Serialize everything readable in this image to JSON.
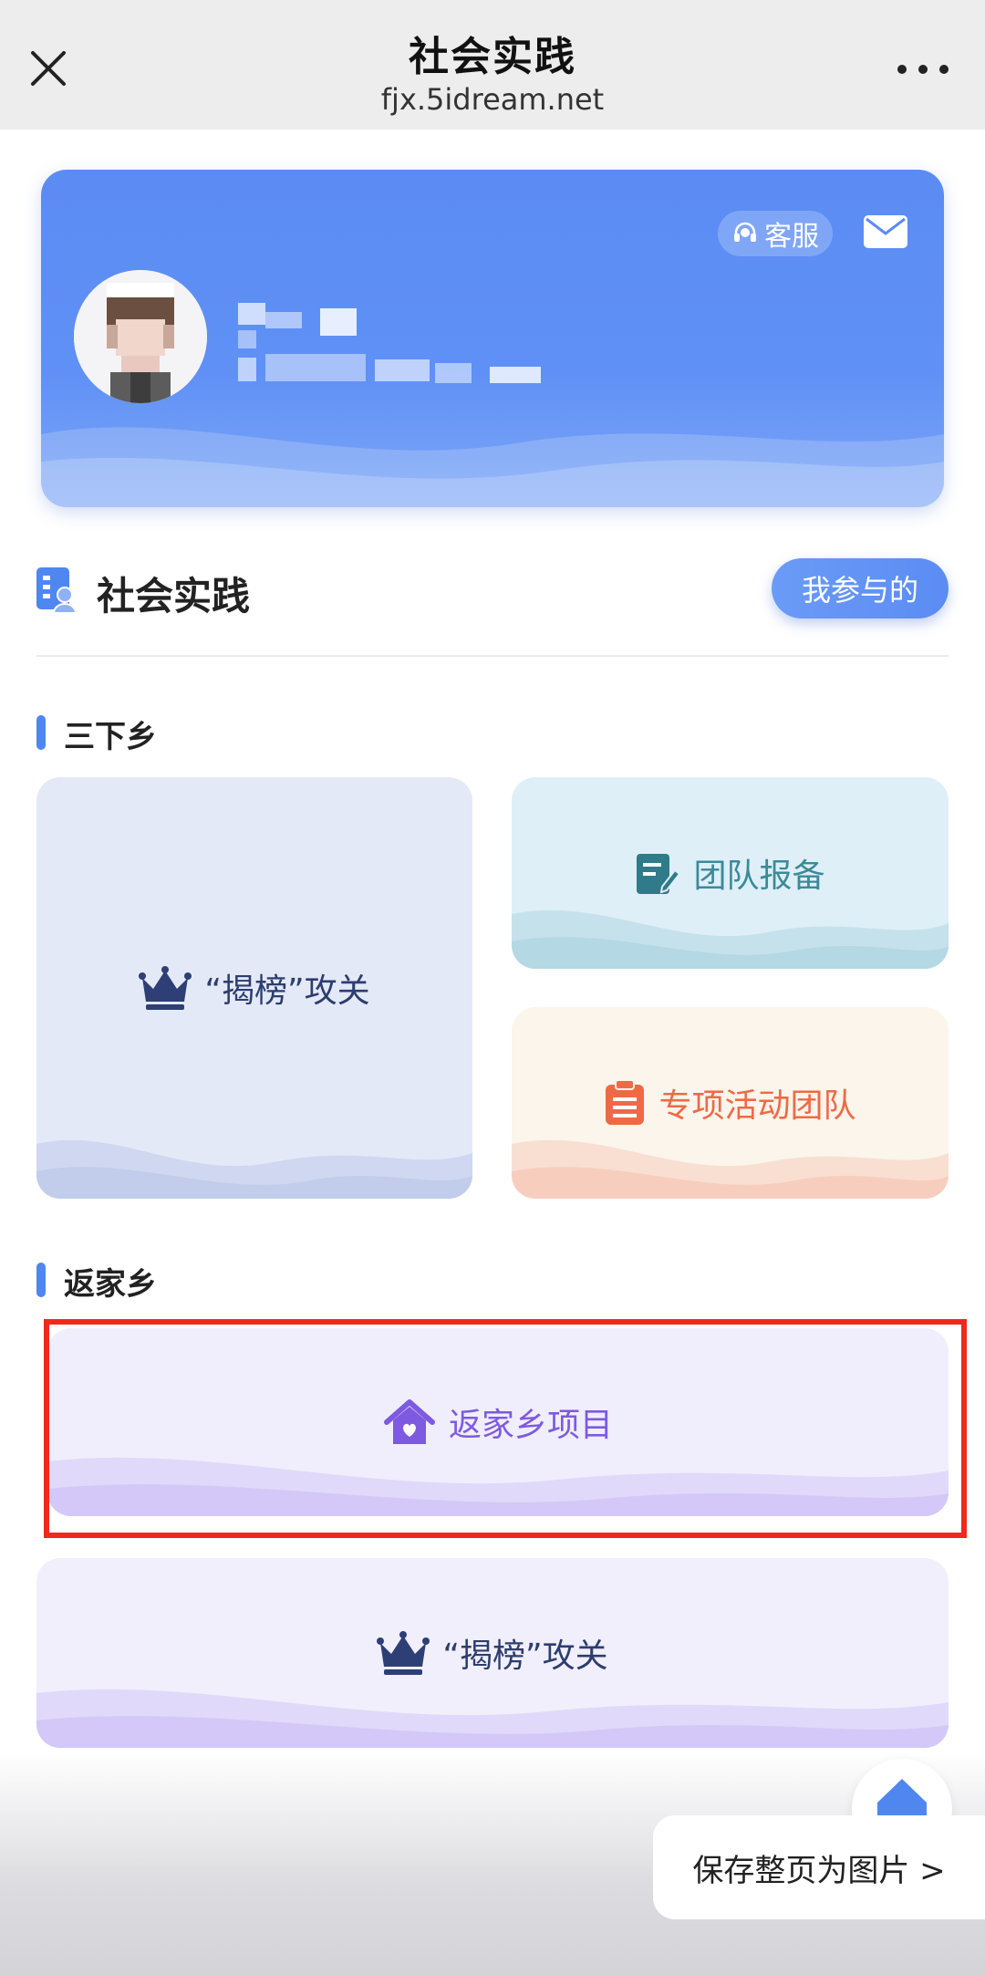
{
  "topbar": {
    "title": "社会实践",
    "url": "fjx.5idream.net"
  },
  "profile": {
    "service_label": "客服",
    "colors": {
      "banner": "#5b8cf3"
    }
  },
  "section": {
    "title": "社会实践",
    "mine_button": "我参与的"
  },
  "groups": [
    {
      "label": "三下乡",
      "tiles": [
        {
          "label": "“揭榜”攻关",
          "icon": "crown-icon"
        },
        {
          "label": "团队报备",
          "icon": "edit-document-icon"
        },
        {
          "label": "专项活动团队",
          "icon": "clipboard-icon"
        }
      ]
    },
    {
      "label": "返家乡",
      "tiles": [
        {
          "label": "返家乡项目",
          "icon": "home-heart-icon"
        },
        {
          "label": "“揭榜”攻关",
          "icon": "crown-icon"
        }
      ]
    }
  ],
  "save_page": "保存整页为图片 >",
  "colors": {
    "accent": "#4f86f0",
    "highlight": "#f0291d",
    "team_text": "#3b8a99",
    "special_text": "#ee6a46",
    "home_text": "#7d5ae0"
  }
}
